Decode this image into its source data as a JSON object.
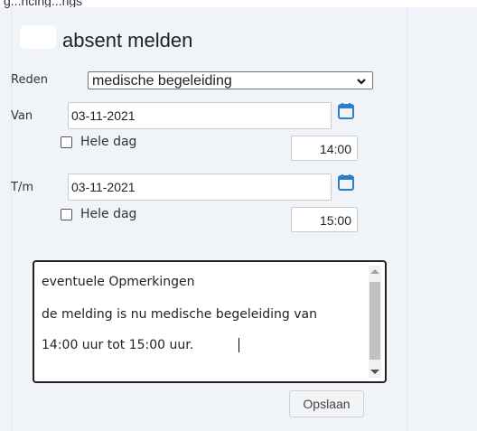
{
  "header": {
    "partial_text": "g...ncing...ngs"
  },
  "form": {
    "title": "absent melden",
    "reason": {
      "label": "Reden",
      "value": "medische begeleiding"
    },
    "from": {
      "label": "Van",
      "date": "03-11-2021",
      "all_day_label": "Hele dag",
      "all_day_checked": false,
      "time": "14:00"
    },
    "until": {
      "label": "T/m",
      "date": "03-11-2021",
      "all_day_label": "Hele dag",
      "all_day_checked": false,
      "time": "15:00"
    },
    "remarks": {
      "lines": [
        "eventuele Opmerkingen",
        "de melding is nu medische begeleiding van",
        "14:00 uur tot 15:00 uur."
      ]
    },
    "save_label": "Opslaan"
  },
  "colors": {
    "accent": "#2e7dc6",
    "background": "#f0f4f8"
  }
}
